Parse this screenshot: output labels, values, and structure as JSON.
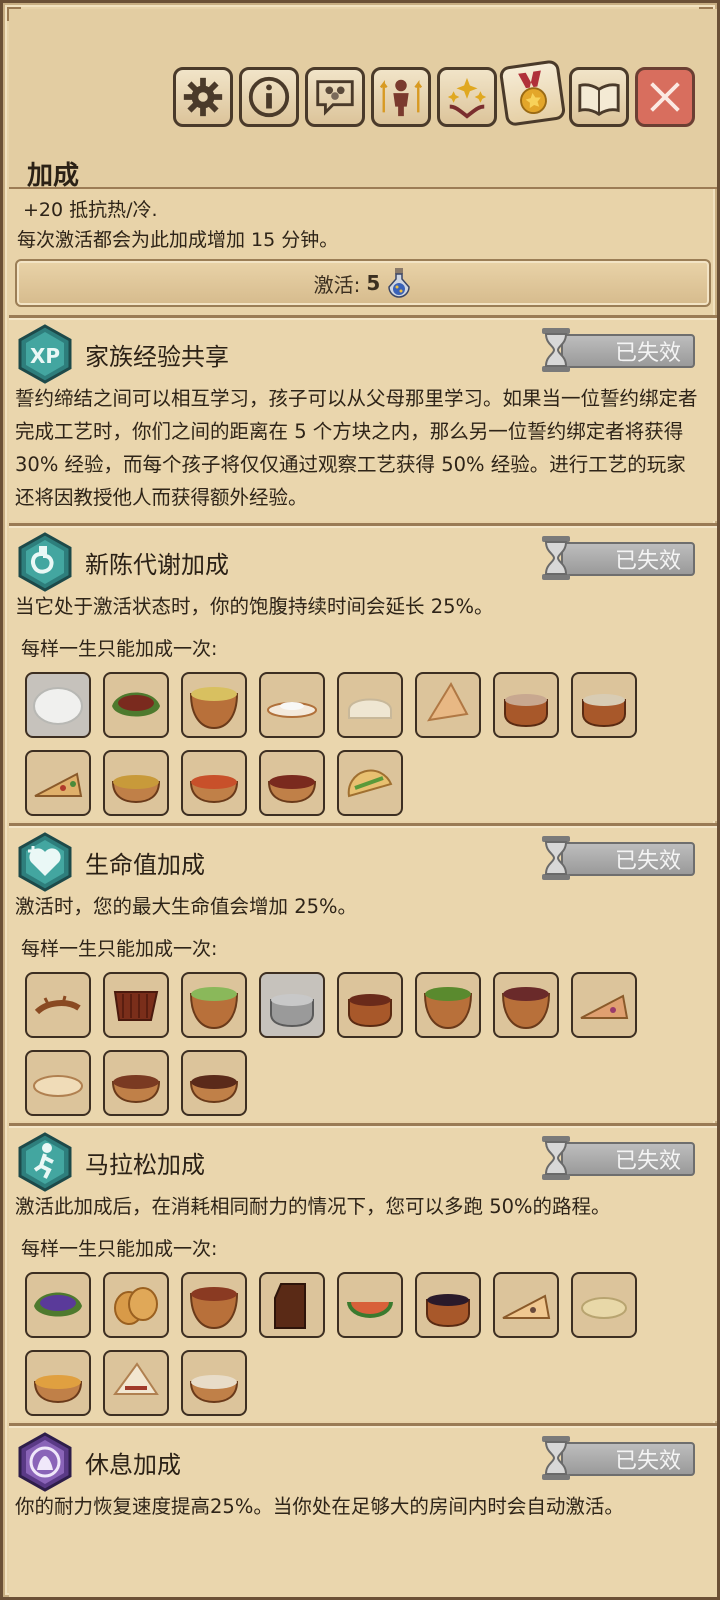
{
  "header": {
    "title": "加成",
    "tabs": [
      {
        "name": "settings",
        "icon": "gear-icon"
      },
      {
        "name": "info",
        "icon": "info-icon"
      },
      {
        "name": "family",
        "icon": "family-chat-icon"
      },
      {
        "name": "attributes",
        "icon": "character-stats-icon"
      },
      {
        "name": "blessings",
        "icon": "sparkle-hands-icon"
      },
      {
        "name": "boosts",
        "icon": "medal-icon",
        "active": true
      },
      {
        "name": "journal",
        "icon": "book-icon"
      },
      {
        "name": "close",
        "icon": "close-icon"
      }
    ]
  },
  "active_boost": {
    "stat": "+20 抵抗热/冷.",
    "description": "每次激活都会为此加成增加 15 分钟。",
    "activate_label": "激活:",
    "activate_count": "5"
  },
  "boosts": [
    {
      "title": "家族经验共享",
      "icon": "xp-icon",
      "status": "已失效",
      "description": "誓约缔结之间可以相互学习，孩子可以从父母那里学习。如果当一位誓约绑定者完成工艺时，你们之间的距离在 5 个方块之内，那么另一位誓约绑定者将获得 30% 经验，而每个孩子将仅仅通过观察工艺获得 50% 经验。进行工艺的玩家还将因教授他人而获得额外经验。",
      "once_label": "",
      "foods": []
    },
    {
      "title": "新陈代谢加成",
      "icon": "stomach-icon",
      "status": "已失效",
      "description": "当它处于激活状态时，你的饱腹持续时间会延长 25%。",
      "once_label": "每样一生只能加成一次:",
      "foods": [
        "dough-icon",
        "leaf-wrap-meat-icon",
        "soup-bowl-icon",
        "fish-plate-icon",
        "bread-icon",
        "pastry-icon",
        "stew-pot-icon",
        "porridge-pot-icon",
        "pizza-icon",
        "salad-bowl-icon",
        "stew-bowl-icon",
        "meat-bowl-icon",
        "taco-icon"
      ]
    },
    {
      "title": "生命值加成",
      "icon": "heart-plus-icon",
      "status": "已失效",
      "description": "激活时，您的最大生命值会增加 25%。",
      "once_label": "每样一生只能加成一次:",
      "foods": [
        "roast-lizard-icon",
        "ribs-icon",
        "salad-pot-icon",
        "silver-pot-icon",
        "bean-pot-icon",
        "green-soup-icon",
        "berry-soup-icon",
        "pizza-slice-icon",
        "flatbread-icon",
        "bean-bowl-icon",
        "meat-stew-bowl-icon"
      ]
    },
    {
      "title": "马拉松加成",
      "icon": "runner-icon",
      "status": "已失效",
      "description": "激活此加成后，在消耗相同耐力的情况下，您可以多跑 50%的路程。",
      "once_label": "每样一生只能加成一次:",
      "foods": [
        "berry-leaf-icon",
        "buns-icon",
        "chili-pot-icon",
        "chocolate-icon",
        "melon-slice-icon",
        "dark-soup-pot-icon",
        "flat-pizza-icon",
        "grain-pile-icon",
        "curry-bowl-icon",
        "wrap-icon",
        "dumpling-bowl-icon"
      ]
    },
    {
      "title": "休息加成",
      "icon": "rest-icon",
      "status": "已失效",
      "description": "你的耐力恢复速度提高25%。当你处在足够大的房间内时会自动激活。",
      "once_label": "",
      "foods": []
    }
  ]
}
